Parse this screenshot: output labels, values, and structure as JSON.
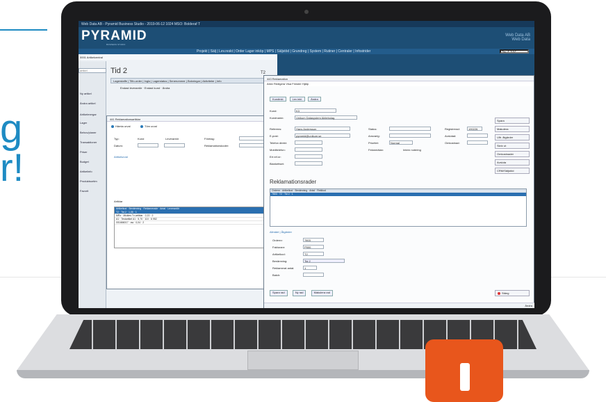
{
  "background": {
    "accent": "#1e8bc3",
    "snippets": [
      "g",
      "r!"
    ]
  },
  "app": {
    "window_title": "Web Data AB - Pyramid Business Studio - 2019-06-12 1024 MSO: Bolderaf T",
    "brand": "PYRAMID",
    "tagline": "BUSINESS STUDIO",
    "company": "Web Data AB",
    "user": "Web Data",
    "menu": [
      "Projekt",
      "Sälj",
      "Lev.reskt",
      "Order Lager inköp",
      "MPS",
      "Säljstöd",
      "Grundreg",
      "System",
      "Rutiner",
      "Centraler",
      "Infostrider"
    ],
    "search_placeholder": "Sök"
  },
  "main": {
    "subwindow_title": "0001 Artikelcentral",
    "search_placeholder": "artikel",
    "title": "Tid 2",
    "title_right": "T2",
    "tabs": [
      "Lagerstaffe",
      "Tilfo-order",
      "Inglo",
      "Lagerstatus",
      "Senerummer",
      "Bokningar",
      "Aktiviteter",
      "Info"
    ],
    "checkbox_labels": [
      "Endast leverantör",
      "Endast kund",
      "Ändra"
    ],
    "nav_items": [
      "Ny artikel",
      "Ändra artikel",
      "Artikelmergar",
      "Lager",
      "Behov/planer",
      "Transaktioner",
      "Priser",
      "Budget",
      "Artikelinfo",
      "Produktsortim",
      "Favorit"
    ]
  },
  "dialog1": {
    "title": "441 Reklamationsartiklar",
    "fetch_label": "Hämta urval",
    "clear_label": "Töm urval",
    "type_label": "Typ:",
    "type_options": [
      "Kund",
      "Leverantör"
    ],
    "date_label": "Datum:",
    "company_label": "Företag:",
    "reason_label": "Reklamationskoder:",
    "article_label": "Artikelurval",
    "grid_tab": "Artiklar",
    "grid_columns": [
      "Artikelkod",
      "Benämning",
      "Reklamerade",
      "Antal",
      "Leverantör"
    ],
    "rows": [
      [
        "T2",
        "Tid 2",
        "1,06",
        "1",
        ""
      ],
      [
        "MRz",
        "Mickles Tv-artiklar",
        "2,22",
        "2",
        ""
      ],
      [
        "A1",
        "Testartikel A1",
        "5,70",
        "110",
        "6 952"
      ],
      [
        "001666017",
        "aw",
        "0,04",
        "2",
        ""
      ]
    ]
  },
  "dialog2": {
    "title": "443 Reklamation",
    "menu": [
      "Arkiv",
      "Redigera",
      "Visa",
      "Fönster",
      "Hjälp"
    ],
    "toolbar_buttons": [
      "Kundinkl.",
      "Lev.inkl.",
      "Ändra"
    ],
    "fields": {
      "kund": "K3",
      "kundnamn": "Unikum Datasystem Aktiebolag",
      "referens": "Hans Andersson",
      "epost": "pyramid@unikum.se",
      "status_label": "Status:",
      "ansvarig_label": "Ansvarig:",
      "prioritet_label": "Prioritet:",
      "prioritet_value": "Normal",
      "registrerad_label": "Registrerad:",
      "registrerad_value": "190226",
      "avslutad_label": "Avslutad:",
      "omkostnad_label": "Omkostnad:",
      "felanmalan_label": "Felanmälan:",
      "intern_label": "Intern notering"
    },
    "labels": [
      "Kund:",
      "Kundnamn:",
      "Referens:",
      "E-post:",
      "Telefon direkt:",
      "Mobiltelefon:",
      "Ert ref.nr:",
      "Blankettset:"
    ],
    "side_buttons": [
      "Spara",
      "Makulera",
      "Ulfr. åtgärder",
      "Skriv ut",
      "Omkostnader",
      "Avsluta",
      "CRM/Säljstöd"
    ],
    "section_title": "Reklamationsrader",
    "grid_columns": [
      "Ordernr",
      "Artikelkod",
      "Benämning",
      "Antal",
      "Reklkod"
    ],
    "grid_row": [
      "7803",
      "T2",
      "Tid 2",
      "1",
      ""
    ],
    "bottom_tabs": [
      "Allmänt",
      "Åtgärder"
    ],
    "detail_labels": [
      "Ordernr:",
      "Fakturanr:",
      "Artikelkod:",
      "Benämning:",
      "Reklamerat antal:",
      "Batch:"
    ],
    "detail_values": [
      "7803",
      "P500",
      "T2",
      "Tid 2",
      "1"
    ],
    "footer_buttons": [
      "Spara rad",
      "Ny rad",
      "Makulera rad"
    ],
    "sign_button": "Stäng",
    "status": "Ändra"
  }
}
